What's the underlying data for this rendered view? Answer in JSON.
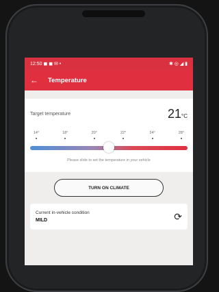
{
  "statusbar": {
    "time": "12:50",
    "left_icons": "◼ ◼ ✉ •",
    "right_icons": "✱ ◎ ◢ ▮"
  },
  "appbar": {
    "back": "←",
    "title": "Temperature"
  },
  "target": {
    "label": "Target temperature",
    "value": "21",
    "unit": "°C"
  },
  "ticks": [
    "14°",
    "18°",
    "20°",
    "22°",
    "24°",
    "28°"
  ],
  "slider_position": 0.5,
  "hint": "Please slide to set the temperature in your vehicle",
  "button": {
    "label": "TURN ON CLIMATE"
  },
  "condition": {
    "label": "Current in-vehicle condition",
    "value": "MILD",
    "refresh_icon": "refresh-icon"
  },
  "colors": {
    "accent": "#e0303f",
    "slider_cool": "#4e8fd6",
    "slider_warm": "#e0303f"
  }
}
